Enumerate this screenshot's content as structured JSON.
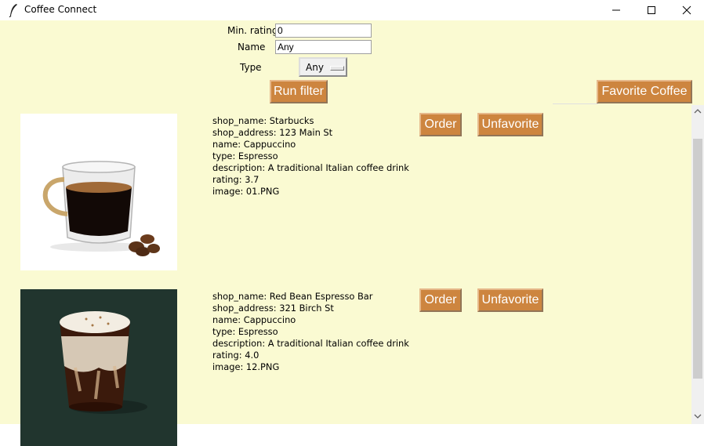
{
  "window": {
    "title": "Coffee Connect"
  },
  "filters": {
    "min_rating_label": "Min. rating",
    "min_rating_value": "0",
    "name_label": "Name",
    "name_value": "Any",
    "type_label": "Type",
    "type_value": "Any",
    "run_filter_label": "Run filter",
    "favorite_label": "Favorite Coffee"
  },
  "cards": [
    {
      "shop_name": "shop_name: Starbucks",
      "shop_address": "shop_address: 123 Main St",
      "name": "name: Cappuccino",
      "type": "type: Espresso",
      "description": "description: A traditional Italian coffee drink",
      "rating": "rating: 3.7",
      "image": "image: 01.PNG",
      "order_label": "Order",
      "unfavorite_label": "Unfavorite"
    },
    {
      "shop_name": "shop_name: Red Bean Espresso Bar",
      "shop_address": "shop_address: 321 Birch St",
      "name": "name: Cappuccino",
      "type": "type: Espresso",
      "description": "description: A traditional Italian coffee drink",
      "rating": "rating: 4.0",
      "image": "image: 12.PNG",
      "order_label": "Order",
      "unfavorite_label": "Unfavorite"
    }
  ],
  "colors": {
    "background": "#fafad2",
    "button": "#cd853f",
    "button_text": "#ffffff"
  }
}
